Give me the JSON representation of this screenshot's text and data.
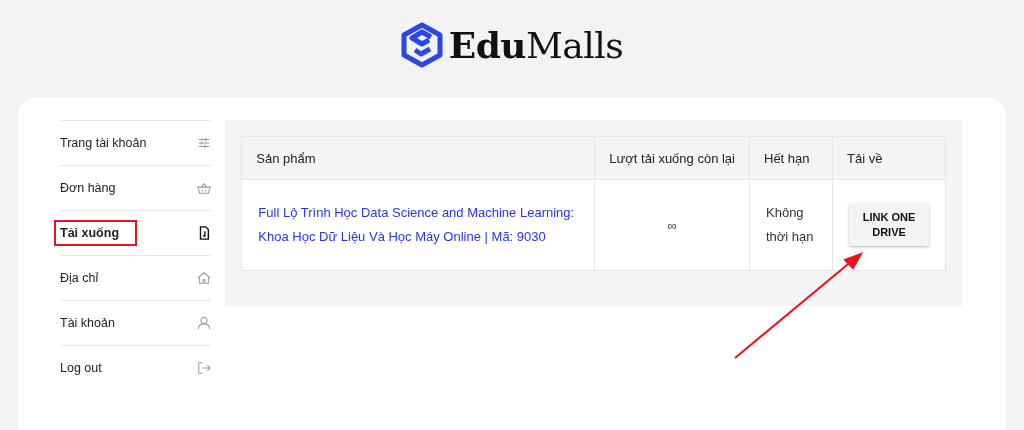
{
  "logo": {
    "bold": "Edu",
    "rest": "Malls"
  },
  "sidebar": {
    "items": [
      {
        "label": "Trang tài khoản",
        "kind": "sliders",
        "selected": false
      },
      {
        "label": "Đơn hàng",
        "kind": "basket",
        "selected": false
      },
      {
        "label": "Tải xuống",
        "kind": "file",
        "selected": true
      },
      {
        "label": "Địa chỉ",
        "kind": "home",
        "selected": false
      },
      {
        "label": "Tài khoản",
        "kind": "user",
        "selected": false
      },
      {
        "label": "Log out",
        "kind": "logout",
        "selected": false
      }
    ]
  },
  "table": {
    "columns": [
      "Sản phẩm",
      "Lượt tải xuống còn lại",
      "Hết hạn",
      "Tải về"
    ],
    "rows": [
      {
        "product": "Full Lộ Trình Học Data Science and Machine Learning: Khoa Học Dữ Liệu Và Học Máy Online | Mã: 9030",
        "remaining": "∞",
        "expires": "Không thời hạn",
        "download": "LINK ONE DRIVE"
      }
    ]
  }
}
